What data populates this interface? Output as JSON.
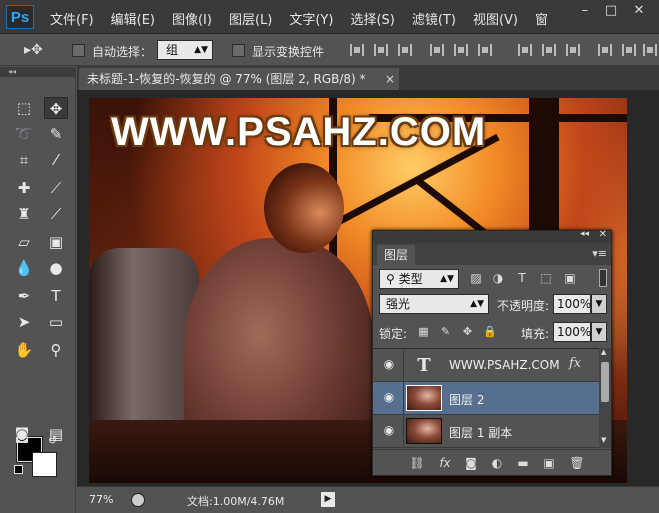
{
  "app": {
    "logo": "Ps",
    "menu": [
      "文件(F)",
      "编辑(E)",
      "图像(I)",
      "图层(L)",
      "文字(Y)",
      "选择(S)",
      "滤镜(T)",
      "视图(V)",
      "窗"
    ],
    "window_controls": [
      "–",
      "□",
      "✕"
    ]
  },
  "options": {
    "move_icon": "▸✥",
    "auto_select_label": "自动选择：",
    "auto_select_value": "组",
    "transform_label": "显示变换控件"
  },
  "document": {
    "tab_title": "未标题-1-恢复的-恢复的 @ 77% (图层 2, RGB/8) *",
    "close": "×",
    "watermark": "WWW.PSAHZ.COM"
  },
  "statusbar": {
    "zoom": "77%",
    "docinfo": "文档:1.00M/4.76M",
    "arrow": "▶"
  },
  "tools": {
    "collapse": "◂◂",
    "icons": [
      "marquee-icon",
      "move-icon",
      "lasso-icon",
      "quick-select-icon",
      "crop-icon",
      "eyedropper-icon",
      "healing-icon",
      "brush-icon",
      "stamp-icon",
      "history-brush-icon",
      "eraser-icon",
      "gradient-icon",
      "blur-icon",
      "dodge-icon",
      "pen-icon",
      "type-icon",
      "path-select-icon",
      "shape-icon",
      "hand-icon",
      "zoom-icon",
      "quickmask-icon",
      "screenmode-icon"
    ]
  },
  "layers_panel": {
    "tab": "图层",
    "filter": "类型",
    "blend_mode": "强光",
    "opacity_label": "不透明度:",
    "opacity_value": "100%",
    "lock_label": "锁定:",
    "fill_label": "填充:",
    "fill_value": "100%",
    "layers": [
      {
        "name": "WWW.PSAHZ.COM",
        "type": "text",
        "fx": "fx",
        "selected": false
      },
      {
        "name": "图层 2",
        "type": "image",
        "selected": true
      },
      {
        "name": "图层 1 副本",
        "type": "image",
        "selected": false
      }
    ]
  },
  "colors": {
    "foreground": "#000000",
    "background": "#ffffff",
    "selected_layer": "#566f8e"
  }
}
